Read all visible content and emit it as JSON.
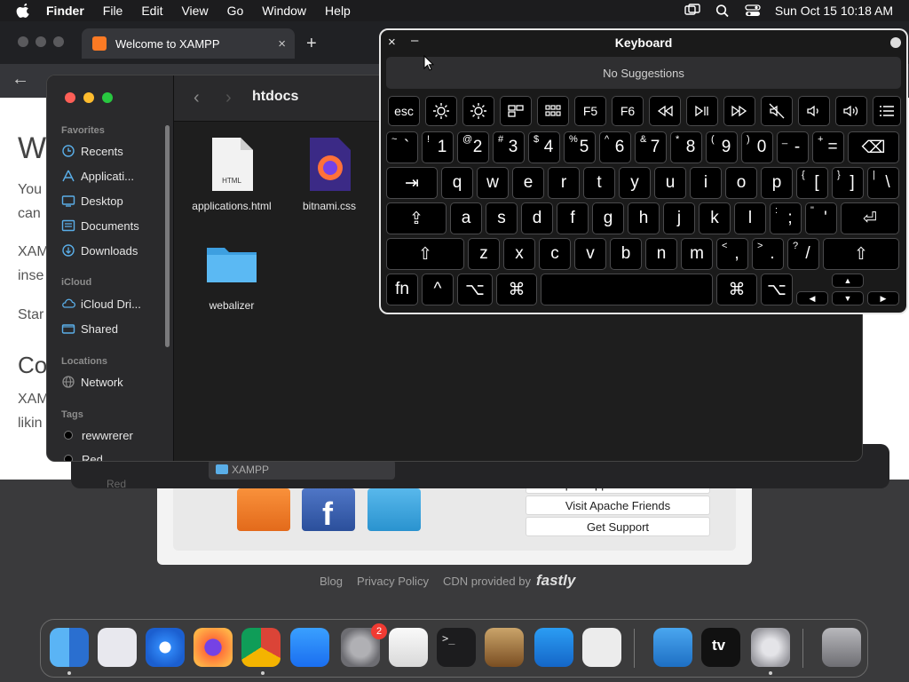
{
  "menubar": {
    "items": [
      "Finder",
      "File",
      "Edit",
      "View",
      "Go",
      "Window",
      "Help"
    ],
    "clock": "Sun Oct 15  10:18 AM"
  },
  "browser": {
    "tab_title": "Welcome to XAMPP",
    "tab_close": "×",
    "new_tab": "+",
    "page_fragments": [
      "W",
      "You",
      "can",
      "XAM",
      "inse",
      "Star",
      "Co",
      "XAM",
      "likin"
    ],
    "links": [
      "Open Application Folder",
      "Visit Apache Friends",
      "Get Support"
    ],
    "footer": {
      "blog": "Blog",
      "privacy": "Privacy Policy",
      "cdn": "CDN provided by",
      "cdn_brand": "fastly"
    }
  },
  "bg_window": {
    "xampp_item": "XAMPP",
    "red_tag": "Red"
  },
  "finder": {
    "title": "htdocs",
    "sidebar": {
      "favorites_header": "Favorites",
      "favorites": [
        "Recents",
        "Applicati...",
        "Desktop",
        "Documents",
        "Downloads"
      ],
      "icloud_header": "iCloud",
      "icloud": [
        "iCloud Dri...",
        "Shared"
      ],
      "locations_header": "Locations",
      "locations": [
        "Network"
      ],
      "tags_header": "Tags",
      "tags": [
        "rewwrerer",
        "Red"
      ]
    },
    "files": [
      {
        "name": "applications.html",
        "kind": "html-file-icon",
        "badge": "HTML"
      },
      {
        "name": "bitnami.css",
        "kind": "firefox-file-icon"
      },
      {
        "name": "webalizer",
        "kind": "folder-icon"
      }
    ]
  },
  "keyboard": {
    "title": "Keyboard",
    "close": "×",
    "minimize": "–",
    "suggestions": "No Suggestions",
    "fn_row": [
      "esc",
      "F5",
      "F6"
    ],
    "number_row": [
      {
        "up": "~",
        "main": "`"
      },
      {
        "up": "!",
        "main": "1"
      },
      {
        "up": "@",
        "main": "2"
      },
      {
        "up": "#",
        "main": "3"
      },
      {
        "up": "$",
        "main": "4"
      },
      {
        "up": "%",
        "main": "5"
      },
      {
        "up": "^",
        "main": "6"
      },
      {
        "up": "&",
        "main": "7"
      },
      {
        "up": "*",
        "main": "8"
      },
      {
        "up": "(",
        "main": "9"
      },
      {
        "up": ")",
        "main": "0"
      },
      {
        "up": "_",
        "main": "-"
      },
      {
        "up": "+",
        "main": "="
      }
    ],
    "row_q": [
      "q",
      "w",
      "e",
      "r",
      "t",
      "y",
      "u",
      "i",
      "o",
      "p"
    ],
    "row_q_extra": [
      {
        "up": "{",
        "main": "["
      },
      {
        "up": "}",
        "main": "]"
      },
      {
        "up": "|",
        "main": "\\"
      }
    ],
    "row_a": [
      "a",
      "s",
      "d",
      "f",
      "g",
      "h",
      "j",
      "k",
      "l"
    ],
    "row_a_extra": [
      {
        "up": ":",
        "main": ";"
      },
      {
        "up": "\"",
        "main": "'"
      }
    ],
    "row_z": [
      "z",
      "x",
      "c",
      "v",
      "b",
      "n",
      "m"
    ],
    "row_z_extra": [
      {
        "up": "<",
        "main": ","
      },
      {
        "up": ">",
        "main": "."
      },
      {
        "up": "?",
        "main": "/"
      }
    ],
    "bottom": {
      "fn": "fn",
      "ctrl": "^",
      "opt": "⌥",
      "cmd": "⌘"
    },
    "arrows": {
      "up": "▲",
      "down": "▼",
      "left": "◀",
      "right": "▶"
    },
    "symbols": {
      "tab": "⇥",
      "caps": "⇪",
      "return": "⏎",
      "shift": "⇧",
      "delete": "⌫"
    }
  },
  "dock": {
    "apps": [
      "finder-icon",
      "launchpad-icon",
      "safari-icon",
      "firefox-icon",
      "chrome-icon",
      "app-store-icon",
      "system-settings-icon",
      "textedit-icon",
      "terminal-icon",
      "garageband-icon",
      "vscode-icon",
      "roblox-icon",
      "weather-icon",
      "appletv-icon",
      "settings-icon",
      "trash-icon"
    ],
    "settings_badge": "2",
    "appletv_label": "tv"
  },
  "colors": {
    "close": "#ff5f57",
    "minimize": "#febc2e",
    "zoom": "#28c840",
    "accent": "#5aaee8"
  }
}
